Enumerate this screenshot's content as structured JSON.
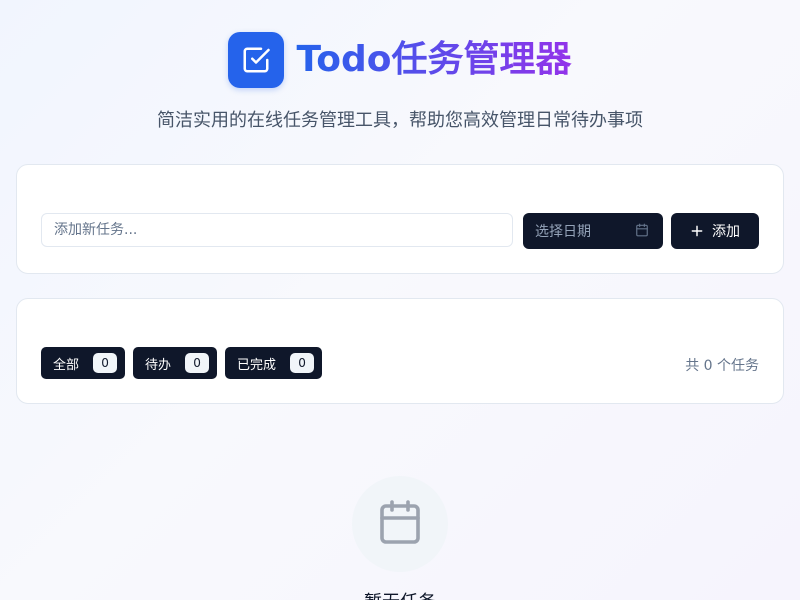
{
  "header": {
    "logo_icon": "check-square-icon",
    "title": "Todo任务管理器",
    "subtitle": "简洁实用的在线任务管理工具，帮助您高效管理日常待办事项"
  },
  "add_task": {
    "input_placeholder": "添加新任务...",
    "input_value": "",
    "date_label": "选择日期",
    "date_icon": "calendar-icon",
    "add_icon": "plus-icon",
    "add_label": "添加"
  },
  "filters": {
    "items": [
      {
        "label": "全部",
        "count": "0"
      },
      {
        "label": "待办",
        "count": "0"
      },
      {
        "label": "已完成",
        "count": "0"
      }
    ],
    "total_text": "共 0 个任务"
  },
  "empty_state": {
    "icon": "calendar-icon",
    "text": "暂无任务"
  },
  "colors": {
    "primary": "#2563eb",
    "accent_purple": "#9333ea",
    "dark_button": "#0f172a",
    "muted_text": "#64748b"
  }
}
